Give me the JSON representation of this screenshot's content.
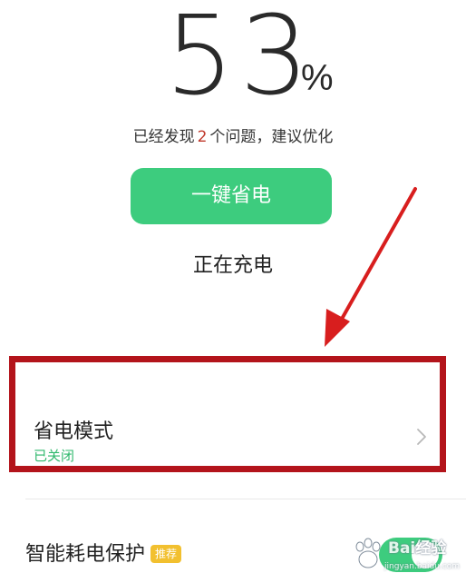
{
  "battery": {
    "percent_value": "53",
    "percent_sign": "%"
  },
  "issues": {
    "prefix": "已经发现",
    "count": "2",
    "suffix": "个问题，建议优化"
  },
  "actions": {
    "one_click_save_label": "一键省电"
  },
  "status": {
    "charging": "正在充电"
  },
  "settings": {
    "power_saving": {
      "title": "省电模式",
      "state": "已关闭"
    },
    "smart_protection": {
      "title": "智能耗电保护",
      "badge": "推荐",
      "enabled": true
    }
  },
  "colors": {
    "accent_green": "#3dcc7e",
    "annotation_red": "#b3141b",
    "issue_count_red": "#c0392b",
    "badge_yellow": "#f2c02f"
  },
  "icons": {
    "row_chevron": "chevron-right-icon",
    "annotation": "red-arrow-icon",
    "watermark": "baidu-paw-icon"
  },
  "watermark": {
    "brand": "Bai",
    "brand_suffix": "经验",
    "url": "jingyan.baidu.com"
  }
}
